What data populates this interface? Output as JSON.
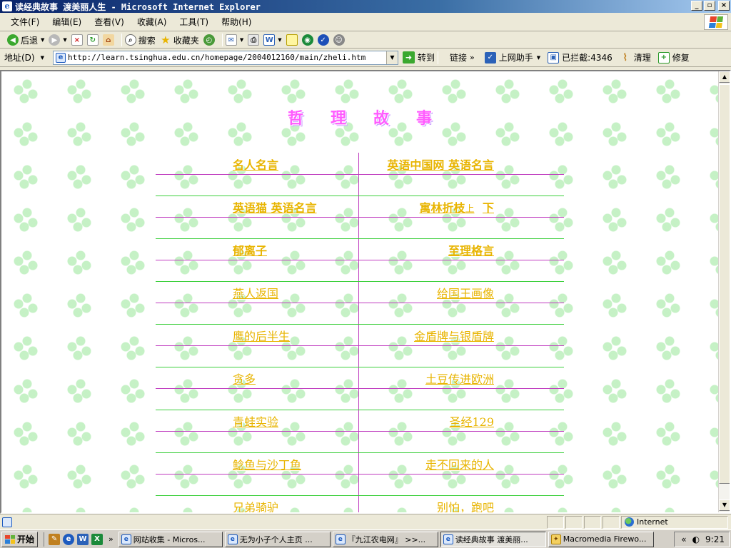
{
  "window": {
    "title": "读经典故事 渡美丽人生 - Microsoft Internet Explorer",
    "buttons": {
      "minimize": "_",
      "maximize": "▫",
      "close": "×"
    }
  },
  "menubar": {
    "items": [
      "文件(F)",
      "编辑(E)",
      "查看(V)",
      "收藏(A)",
      "工具(T)",
      "帮助(H)"
    ]
  },
  "toolbar": {
    "back": "后退",
    "search": "搜索",
    "favorites": "收藏夹"
  },
  "addressbar": {
    "label": "地址(D)",
    "url": "http://learn.tsinghua.edu.cn/homepage/2004012160/main/zheli.htm",
    "go": "转到",
    "links": "链接",
    "helper": "上网助手",
    "blocked": "已拦截:4346",
    "clean": "清理",
    "repair": "修复"
  },
  "page": {
    "heading": "哲理故事",
    "rows": [
      {
        "left": "名人名言",
        "right": "英语中国网 英语名言",
        "left_bold": true,
        "right_bold": true
      },
      {
        "left": "英语猫 英语名言",
        "right": "寓林折枝",
        "right_suffix_a": "上",
        "right_suffix_b": "下",
        "left_bold": true,
        "right_bold": true
      },
      {
        "left": "郁离子",
        "right": "至理格言",
        "left_bold": true,
        "right_bold": true
      },
      {
        "left": "燕人返国",
        "right": "给国王画像",
        "left_bold": false,
        "right_bold": false
      },
      {
        "left": "鹰的后半生",
        "right": "金盾牌与银盾牌",
        "left_bold": false,
        "right_bold": false
      },
      {
        "left": "贪多",
        "right": "土豆传进欧洲",
        "left_bold": false,
        "right_bold": false
      },
      {
        "left": "青蛙实验",
        "right": "圣经129",
        "left_bold": false,
        "right_bold": false
      },
      {
        "left": "鲶鱼与沙丁鱼",
        "right": "走不回来的人",
        "left_bold": false,
        "right_bold": false
      },
      {
        "left": "兄弟骑驴",
        "right": "别怕，跑吧",
        "left_bold": false,
        "right_bold": false
      }
    ]
  },
  "statusbar": {
    "zone": "Internet"
  },
  "taskbar": {
    "start": "开始",
    "tasks": [
      {
        "label": "网站收集 - Micros...",
        "active": false
      },
      {
        "label": "无为小子个人主页 ...",
        "active": false
      },
      {
        "label": "『九江农电网』 >>...",
        "active": false
      },
      {
        "label": "读经典故事 渡美丽...",
        "active": true
      },
      {
        "label": "Macromedia Firewo...",
        "active": false
      }
    ],
    "clock": "9:21",
    "tray_chevron": "«"
  },
  "colors": {
    "link": "#e8b400",
    "heading": "#ff5cff",
    "line_magenta": "#c03cc0",
    "line_green": "#3ccf3c",
    "titlebar": "#0a246a"
  }
}
